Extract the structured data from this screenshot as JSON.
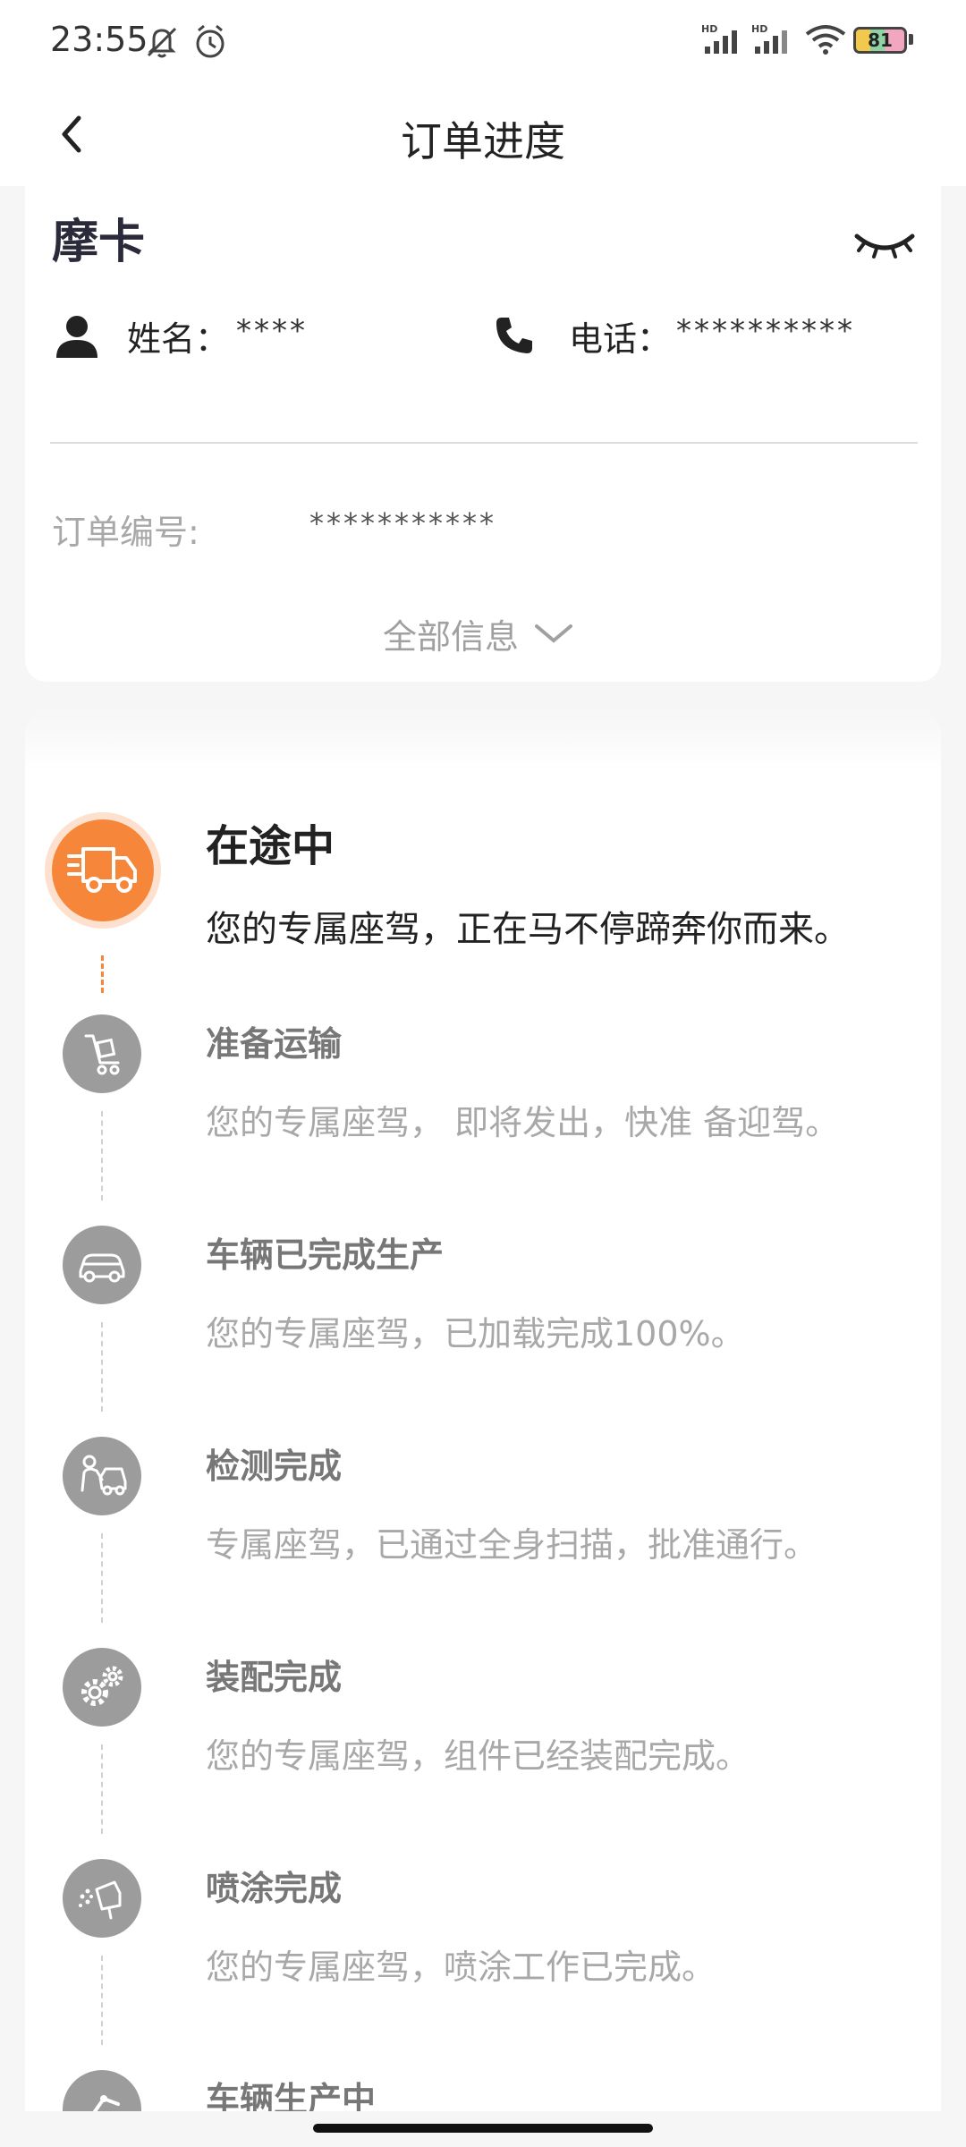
{
  "status_bar": {
    "time": "23:55",
    "icons": [
      "mute-icon",
      "alarm-icon",
      "signal-hd-icon",
      "signal-hd-icon",
      "wifi-icon",
      "battery-icon"
    ],
    "battery": "81"
  },
  "header": {
    "title": "订单进度",
    "back_icon": "back-arrow-icon"
  },
  "info_card": {
    "model_name": "摩卡",
    "visibility_icon": "eye-closed-icon",
    "name_label": "姓名：",
    "name_value": "****",
    "phone_label": "电话：",
    "phone_value": "**********",
    "order_label": "订单编号:",
    "order_value": "***********",
    "expand_label": "全部信息"
  },
  "progress": {
    "current": {
      "title": "在途中",
      "desc": "您的专属座驾，正在马不停蹄奔你而来。",
      "icon": "truck-icon",
      "accent": "#f6873a"
    },
    "steps": [
      {
        "title": "准备运输",
        "desc": "您的专属座驾， 即将发出，快准 备迎驾。",
        "icon": "cart-icon"
      },
      {
        "title": "车辆已完成生产",
        "desc": "您的专属座驾，已加载完成100%。",
        "icon": "car-icon"
      },
      {
        "title": "检测完成",
        "desc": "专属座驾，已通过全身扫描，批准通行。",
        "icon": "inspection-icon"
      },
      {
        "title": "装配完成",
        "desc": "您的专属座驾，组件已经装配完成。",
        "icon": "gears-icon"
      },
      {
        "title": "喷涂完成",
        "desc": "您的专属座驾，喷涂工作已完成。",
        "icon": "spray-icon"
      },
      {
        "title": "车辆生产中",
        "desc": "",
        "icon": "robot-arm-icon"
      }
    ]
  }
}
